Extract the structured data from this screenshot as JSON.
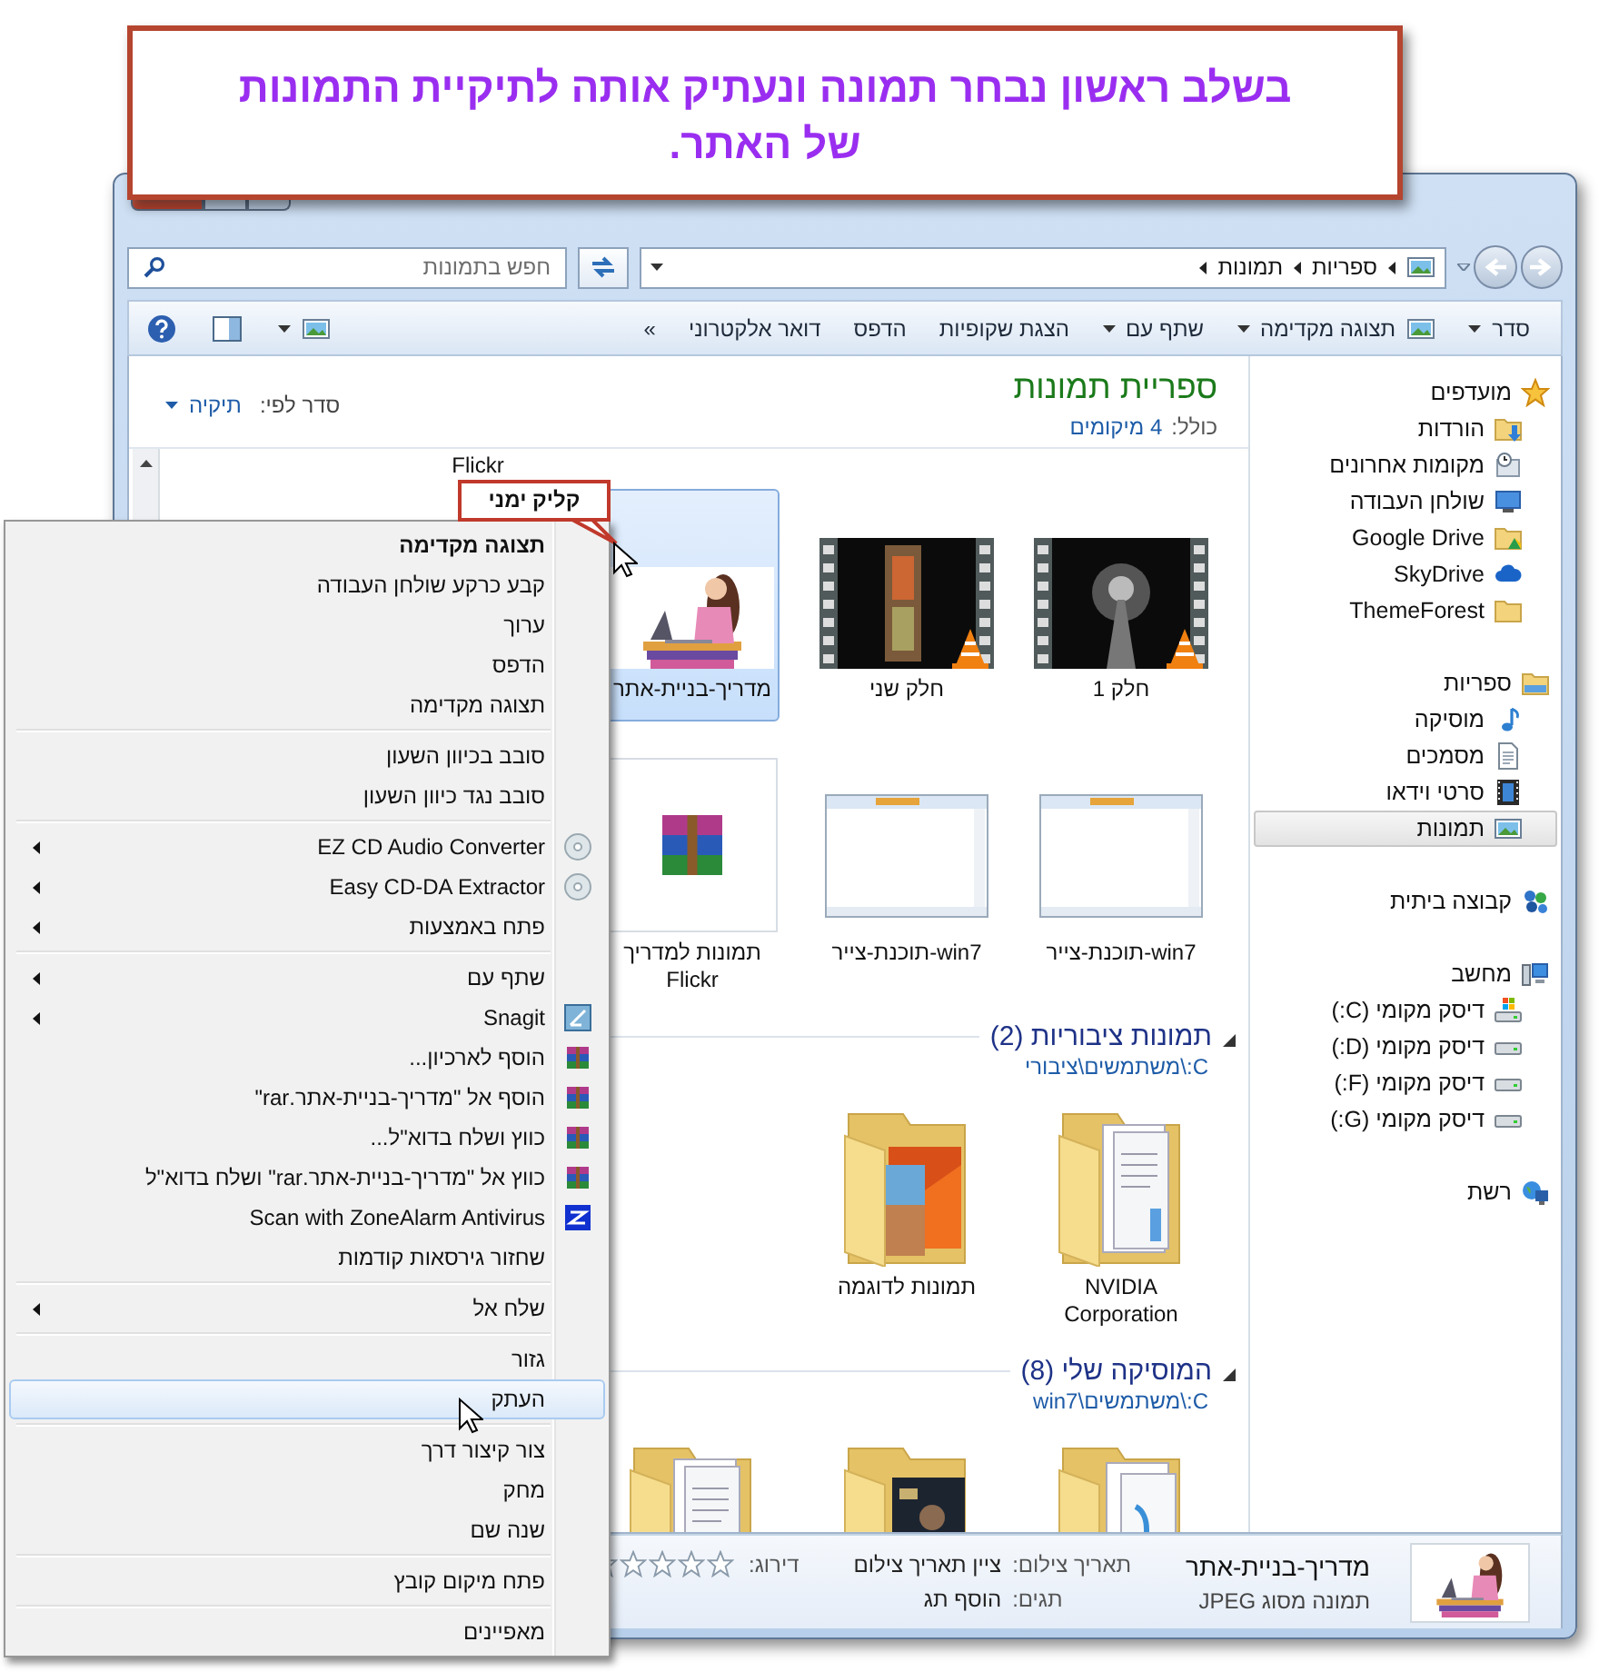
{
  "banner": {
    "text": "בשלב ראשון נבחר תמונה ונעתיק אותה לתיקיית התמונות של האתר."
  },
  "callout": {
    "text": "קליק ימני"
  },
  "address": {
    "crumbs": [
      "ספריות",
      "תמונות"
    ]
  },
  "search": {
    "placeholder": "חפש בתמונות"
  },
  "toolbar": [
    {
      "kind": "menu",
      "label": "סדר"
    },
    {
      "kind": "menu-icon",
      "label": "תצוגה מקדימה"
    },
    {
      "kind": "menu",
      "label": "שתף עם"
    },
    {
      "kind": "button",
      "label": "הצגת שקופיות"
    },
    {
      "kind": "button",
      "label": "הדפס"
    },
    {
      "kind": "button",
      "label": "דואר אלקטרוני"
    },
    {
      "kind": "overflow",
      "label": "»"
    }
  ],
  "nav": [
    {
      "kind": "star",
      "label": "מועדפים",
      "selected": false,
      "children": [
        {
          "kind": "download-folder",
          "label": "הורדות",
          "selected": false
        },
        {
          "kind": "recent",
          "label": "מקומות אחרונים",
          "selected": false
        },
        {
          "kind": "desktop",
          "label": "שולחן העבודה",
          "selected": false
        },
        {
          "kind": "drive-folder",
          "label": "Google Drive",
          "selected": false
        },
        {
          "kind": "cloud",
          "label": "SkyDrive",
          "selected": false
        },
        {
          "kind": "folder",
          "label": "ThemeForest",
          "selected": false
        }
      ]
    },
    {
      "kind": "library",
      "label": "ספריות",
      "selected": false,
      "children": [
        {
          "kind": "music",
          "label": "מוסיקה",
          "selected": false
        },
        {
          "kind": "document",
          "label": "מסמכים",
          "selected": false
        },
        {
          "kind": "video",
          "label": "סרטי וידאו",
          "selected": false
        },
        {
          "kind": "picture",
          "label": "תמונות",
          "selected": true
        }
      ]
    },
    {
      "kind": "homegroup",
      "label": "קבוצה ביתית",
      "selected": false
    },
    {
      "kind": "computer",
      "label": "מחשב",
      "selected": false,
      "children": [
        {
          "kind": "windows-disk",
          "label": "דיסק מקומי (C:)",
          "selected": false
        },
        {
          "kind": "disk",
          "label": "דיסק מקומי (D:)",
          "selected": false
        },
        {
          "kind": "disk",
          "label": "דיסק מקומי (F:)",
          "selected": false
        },
        {
          "kind": "disk",
          "label": "דיסק מקומי (G:)",
          "selected": false
        }
      ]
    },
    {
      "kind": "network",
      "label": "רשת",
      "selected": false
    }
  ],
  "content": {
    "title": "ספריית תמונות",
    "includes_label": "כולל:",
    "includes_link": "4 מיקומים",
    "arrange_label": "סדר לפי:",
    "arrange_value": "תיקיה",
    "top_label": "Flickr",
    "items": [
      {
        "kind": "video",
        "label": "חלק 1",
        "selected": false
      },
      {
        "kind": "video",
        "label": "חלק שני",
        "selected": false
      },
      {
        "label": "מדריך-בניית-אתר",
        "selected": true
      },
      {
        "kind": "screenshot",
        "label": "win7-תוכנת-צייר",
        "selected": false
      },
      {
        "kind": "screenshot",
        "label": "win7-תוכנת-צייר",
        "selected": false
      },
      {
        "kind": "archive",
        "label": "תמונות למדריך Flickr",
        "selected": false
      }
    ],
    "groups": [
      {
        "title": "תמונות ציבוריות (2)",
        "path": "C:\\משתמשים\\ציבורי",
        "items": [
          {
            "kind": "docs-folder",
            "label": "NVIDIA Corporation",
            "selected": false
          },
          {
            "kind": "pictures-folder",
            "label": "תמונות לדוגמה",
            "selected": false
          }
        ]
      },
      {
        "title": "המוסיקה שלי (8)",
        "path": "C:\\משתמשים\\win7",
        "items": [
          {
            "kind": "music-folder",
            "selected": false
          },
          {
            "kind": "album-folder",
            "selected": false
          },
          {
            "kind": "docs-folder",
            "selected": false
          }
        ]
      }
    ]
  },
  "details": {
    "name": "מדריך-בניית-אתר",
    "type": "תמונה מסוג JPEG",
    "fields": [
      {
        "label": "תאריך צילום:",
        "value": "ציין תאריך צילום"
      },
      {
        "label": "תגים:",
        "value": "הוסף תג"
      }
    ],
    "rating_label": "דירוג:",
    "stars": 0
  },
  "menu": [
    {
      "kind": "plain",
      "label": "תצוגה מקדימה",
      "default": true,
      "submenu": false,
      "selected": false
    },
    {
      "kind": "plain",
      "label": "קבע כרקע שולחן העבודה",
      "default": false,
      "submenu": false,
      "selected": false
    },
    {
      "kind": "plain",
      "label": "ערוך",
      "default": false,
      "submenu": false,
      "selected": false
    },
    {
      "kind": "plain",
      "label": "הדפס",
      "default": false,
      "submenu": false,
      "selected": false
    },
    {
      "kind": "plain",
      "label": "תצוגה מקדימה",
      "default": false,
      "submenu": false,
      "selected": false
    },
    {
      "kind": "separator"
    },
    {
      "kind": "plain",
      "label": "סובב בכיוון השעון",
      "default": false,
      "submenu": false,
      "selected": false
    },
    {
      "kind": "plain",
      "label": "סובב נגד כיוון השעון",
      "default": false,
      "submenu": false,
      "selected": false
    },
    {
      "kind": "separator"
    },
    {
      "kind": "disc",
      "label": "EZ CD Audio Converter",
      "default": false,
      "submenu": true,
      "selected": false
    },
    {
      "kind": "disc",
      "label": "Easy CD-DA Extractor",
      "default": false,
      "submenu": true,
      "selected": false
    },
    {
      "kind": "plain",
      "label": "פתח באמצעות",
      "default": false,
      "submenu": true,
      "selected": false
    },
    {
      "kind": "separator"
    },
    {
      "kind": "plain",
      "label": "שתף עם",
      "default": false,
      "submenu": true,
      "selected": false
    },
    {
      "kind": "capture",
      "label": "Snagit",
      "default": false,
      "submenu": true,
      "selected": false
    },
    {
      "kind": "archive",
      "label": "הוסף לארכיון...",
      "default": false,
      "submenu": false,
      "selected": false
    },
    {
      "kind": "archive",
      "label": "הוסף אל \"מדריך-בניית-אתר.rar\"",
      "default": false,
      "submenu": false,
      "selected": false
    },
    {
      "kind": "archive",
      "label": "כווץ ושלח בדוא\"ל...",
      "default": false,
      "submenu": false,
      "selected": false
    },
    {
      "kind": "archive",
      "label": "כווץ אל \"מדריך-בניית-אתר.rar\" ושלח בדוא\"ל",
      "default": false,
      "submenu": false,
      "selected": false
    },
    {
      "kind": "scanner",
      "label": "Scan with ZoneAlarm Antivirus",
      "default": false,
      "submenu": false,
      "selected": false
    },
    {
      "kind": "plain",
      "label": "שחזור גירסאות קודמות",
      "default": false,
      "submenu": false,
      "selected": false
    },
    {
      "kind": "separator"
    },
    {
      "kind": "plain",
      "label": "שלח אל",
      "default": false,
      "submenu": true,
      "selected": false
    },
    {
      "kind": "separator"
    },
    {
      "kind": "plain",
      "label": "גזור",
      "default": false,
      "submenu": false,
      "selected": false
    },
    {
      "kind": "plain",
      "label": "העתק",
      "default": false,
      "submenu": false,
      "selected": true
    },
    {
      "kind": "separator"
    },
    {
      "kind": "plain",
      "label": "צור קיצור דרך",
      "default": false,
      "submenu": false,
      "selected": false
    },
    {
      "kind": "plain",
      "label": "מחק",
      "default": false,
      "submenu": false,
      "selected": false
    },
    {
      "kind": "plain",
      "label": "שנה שם",
      "default": false,
      "submenu": false,
      "selected": false
    },
    {
      "kind": "separator"
    },
    {
      "kind": "plain",
      "label": "פתח מיקום קובץ",
      "default": false,
      "submenu": false,
      "selected": false
    },
    {
      "kind": "separator"
    },
    {
      "kind": "plain",
      "label": "מאפיינים",
      "default": false,
      "submenu": false,
      "selected": false
    }
  ]
}
